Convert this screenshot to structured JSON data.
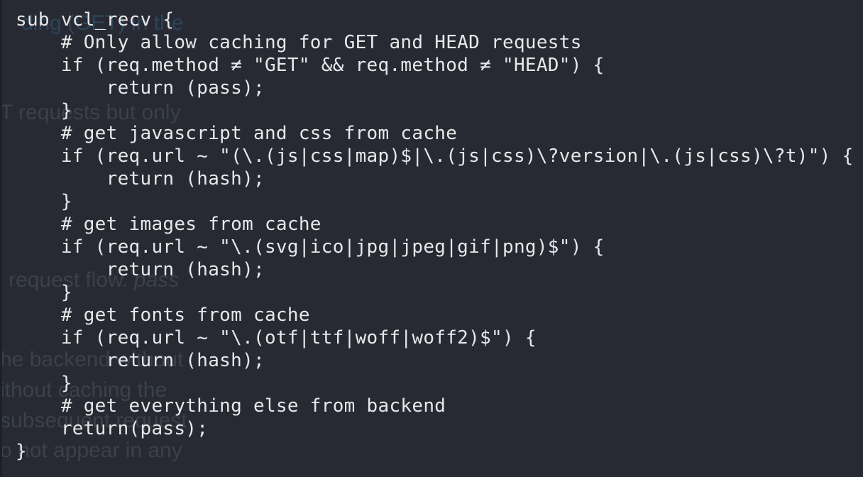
{
  "background_text": [
    {
      "text": "ding (GET) in the",
      "style": "blue"
    },
    {
      "text": "T requests but only",
      "style": ""
    },
    {
      "text": "request flow. pass",
      "style": "italic"
    },
    {
      "text": "he backend without",
      "style": ""
    },
    {
      "text": "ithout caching the",
      "style": ""
    },
    {
      "text": "subsequent request",
      "style": ""
    },
    {
      "text": "o not appear in any",
      "style": ""
    }
  ],
  "code": {
    "language": "VCL",
    "lines": [
      "sub vcl_recv {",
      "    # Only allow caching for GET and HEAD requests",
      "    if (req.method ≠ \"GET\" && req.method ≠ \"HEAD\") {",
      "        return (pass);",
      "    }",
      "    # get javascript and css from cache",
      "    if (req.url ~ \"(\\.(js|css|map)$|\\.(js|css)\\?version|\\.(js|css)\\?t)\") {",
      "        return (hash);",
      "    }",
      "    # get images from cache",
      "    if (req.url ~ \"\\.(svg|ico|jpg|jpeg|gif|png)$\") {",
      "        return (hash);",
      "    }",
      "    # get fonts from cache",
      "    if (req.url ~ \"\\.(otf|ttf|woff|woff2)$\") {",
      "        return (hash);",
      "    }",
      "    # get everything else from backend",
      "    return(pass);",
      "}"
    ]
  },
  "colors": {
    "background": "#272a33",
    "code_text": "#e8e8ea",
    "ghost_text": "#3c4049"
  }
}
